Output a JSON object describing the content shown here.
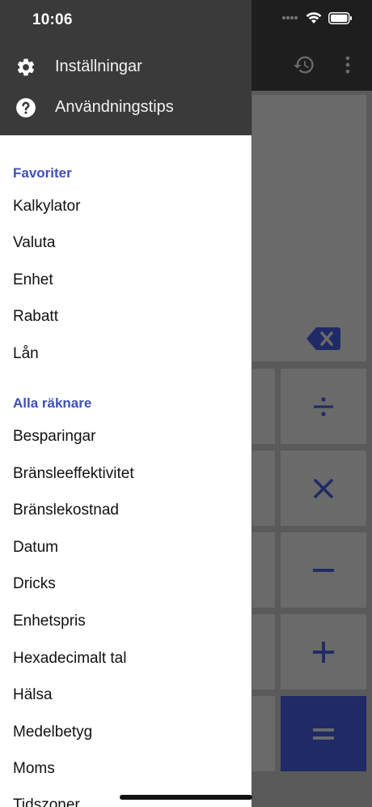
{
  "status": {
    "time": "10:06"
  },
  "drawer": {
    "header_items": [
      {
        "label": "Inställningar",
        "icon": "gear-icon"
      },
      {
        "label": "Användningstips",
        "icon": "help-icon"
      }
    ],
    "favorites": {
      "title": "Favoriter",
      "items": [
        "Kalkylator",
        "Valuta",
        "Enhet",
        "Rabatt",
        "Lån"
      ]
    },
    "all": {
      "title": "Alla räknare",
      "items": [
        "Besparingar",
        "Bränsleeffektivitet",
        "Bränslekostnad",
        "Datum",
        "Dricks",
        "Enhetspris",
        "Hexadecimalt tal",
        "Hälsa",
        "Medelbetyg",
        "Moms",
        "Tidszoner"
      ]
    }
  },
  "colors": {
    "accent": "#3f51b5",
    "header_bg": "#3a3a3a",
    "equals_key": "#1f2a66",
    "operator": "#1f2a66"
  }
}
